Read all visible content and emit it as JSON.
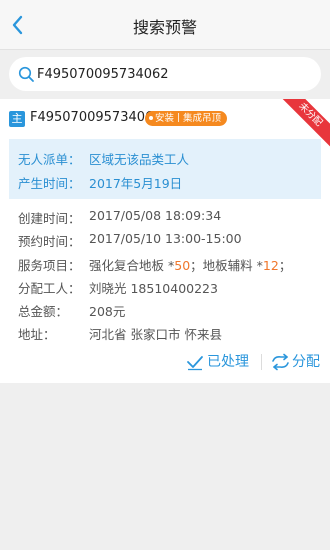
{
  "header": {
    "title": "搜索预警",
    "back_icon": "chevron-left-icon"
  },
  "search": {
    "value": "F495070095734062",
    "placeholder": ""
  },
  "card": {
    "type_badge": "主",
    "order_no": "F495070095734062",
    "tags": [
      "安装",
      "集成吊顶"
    ],
    "corner_label": "未分配",
    "highlight": {
      "rows": [
        {
          "label": "无人派单：",
          "value": "区域无该品类工人"
        },
        {
          "label": "产生时间：",
          "value": "2017年5月19日"
        }
      ]
    },
    "details": {
      "created": {
        "label": "创建时间：",
        "value": "2017/05/08 18:09:34"
      },
      "appointment": {
        "label": "预约时间：",
        "value": "2017/05/10 13:00-15:00"
      },
      "service": {
        "label": "服务项目：",
        "item1": "强化复合地板",
        "star1": " *",
        "qty1": "50",
        "sep": "；",
        "item2": "地板辅料",
        "star2": " *",
        "qty2": "12",
        "end": "；"
      },
      "worker": {
        "label": "分配工人：",
        "value": "刘晓光  18510400223"
      },
      "total": {
        "label": "总金额：",
        "value": "208元"
      },
      "address": {
        "label": "地址：",
        "value": "河北省  张家口市  怀来县"
      }
    },
    "actions": {
      "processed": "已处理",
      "assign": "分配"
    }
  },
  "colors": {
    "accent": "#2a96dc",
    "orange": "#f5891f",
    "red_corner": "#e8363c",
    "highlight_bg": "#e3f1fb"
  }
}
